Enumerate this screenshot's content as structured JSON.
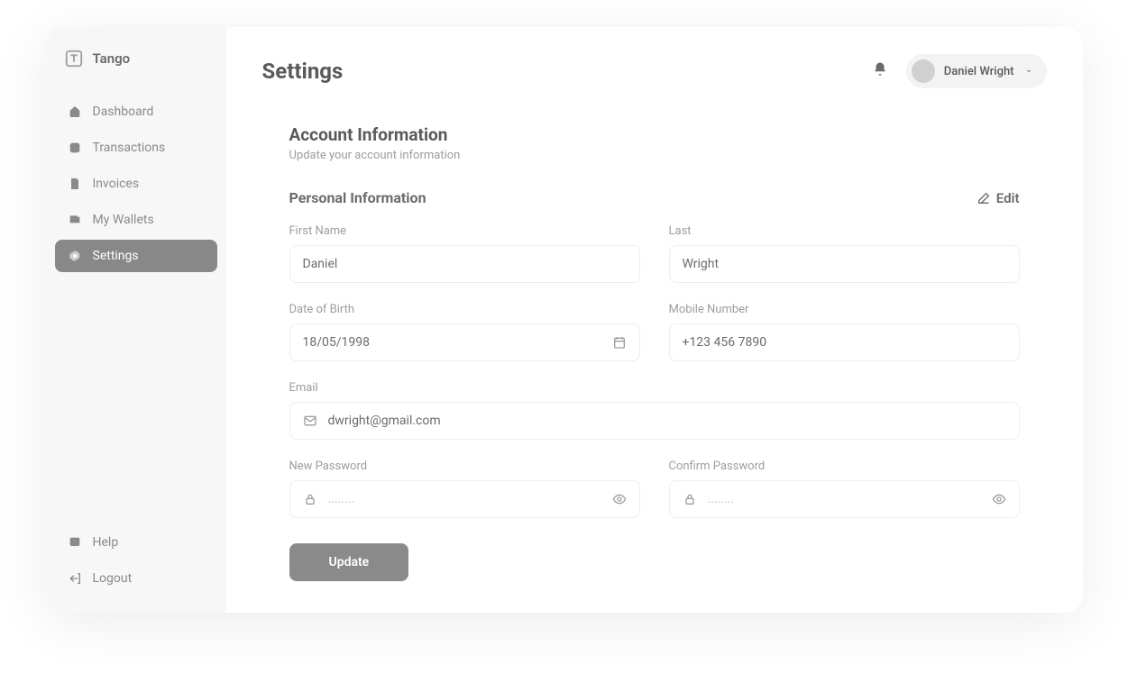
{
  "brand": {
    "name": "Tango"
  },
  "nav": {
    "items": [
      {
        "label": "Dashboard"
      },
      {
        "label": "Transactions"
      },
      {
        "label": "Invoices"
      },
      {
        "label": "My Wallets"
      },
      {
        "label": "Settings"
      }
    ],
    "bottom": [
      {
        "label": "Help"
      },
      {
        "label": "Logout"
      }
    ]
  },
  "header": {
    "title": "Settings",
    "user_name": "Daniel Wright"
  },
  "account": {
    "title": "Account Information",
    "subtitle": "Update your account information",
    "personal_title": "Personal Information",
    "edit_label": "Edit"
  },
  "form": {
    "first_name": {
      "label": "First Name",
      "value": "Daniel"
    },
    "last_name": {
      "label": "Last",
      "value": "Wright"
    },
    "dob": {
      "label": "Date of Birth",
      "value": "18/05/1998"
    },
    "mobile": {
      "label": "Mobile Number",
      "value": "+123 456 7890"
    },
    "email": {
      "label": "Email",
      "value": "dwright@gmail.com"
    },
    "new_pw": {
      "label": "New Password",
      "placeholder": "........"
    },
    "confirm_pw": {
      "label": "Confirm Password",
      "placeholder": "........"
    },
    "update_label": "Update"
  }
}
